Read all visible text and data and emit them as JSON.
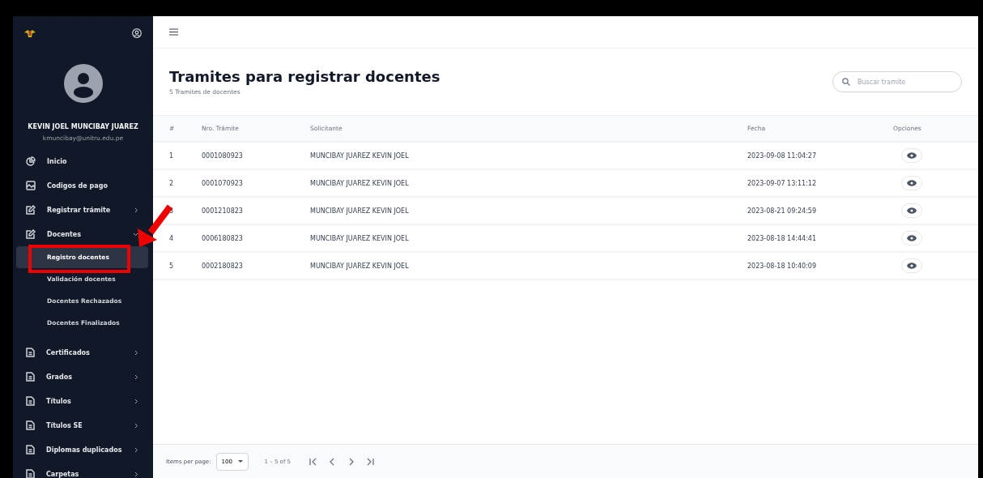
{
  "user": {
    "name": "KEVIN JOEL MUNCIBAY JUAREZ",
    "email": "kmuncibay@unitru.edu.pe"
  },
  "sidebar": {
    "items": [
      {
        "label": "Inicio",
        "kind": "chart",
        "expandable": false
      },
      {
        "label": "Codigos de pago",
        "kind": "image",
        "expandable": false
      },
      {
        "label": "Registrar trámite",
        "kind": "edit",
        "expandable": true,
        "expanded": false
      },
      {
        "label": "Docentes",
        "kind": "edit",
        "expandable": true,
        "expanded": true,
        "children": [
          {
            "label": "Registro docentes",
            "selected": true
          },
          {
            "label": "Validación docentes",
            "selected": false
          },
          {
            "label": "Docentes Rechazados",
            "selected": false
          },
          {
            "label": "Docentes Finalizados",
            "selected": false
          }
        ]
      },
      {
        "label": "Certificados",
        "kind": "doc",
        "expandable": true,
        "expanded": false
      },
      {
        "label": "Grados",
        "kind": "doc",
        "expandable": true,
        "expanded": false
      },
      {
        "label": "Títulos",
        "kind": "doc",
        "expandable": true,
        "expanded": false
      },
      {
        "label": "Títulos SE",
        "kind": "doc",
        "expandable": true,
        "expanded": false
      },
      {
        "label": "Diplomas duplicados",
        "kind": "doc",
        "expandable": true,
        "expanded": false
      },
      {
        "label": "Carpetas",
        "kind": "doc",
        "expandable": true,
        "expanded": false
      }
    ]
  },
  "header": {
    "title": "Tramites para registrar docentes",
    "subtitle": "5 Tramites de docentes"
  },
  "search": {
    "placeholder": "Buscar tramite"
  },
  "table": {
    "columns": [
      "#",
      "Nro. Trámite",
      "Solicitante",
      "Fecha",
      "Opciones"
    ],
    "rows": [
      {
        "index": "1",
        "number": "0001080923",
        "applicant": "MUNCIBAY JUAREZ KEVIN JOEL",
        "date": "2023-09-08 11:04:27"
      },
      {
        "index": "2",
        "number": "0001070923",
        "applicant": "MUNCIBAY JUAREZ KEVIN JOEL",
        "date": "2023-09-07 13:11:12"
      },
      {
        "index": "3",
        "number": "0001210823",
        "applicant": "MUNCIBAY JUAREZ KEVIN JOEL",
        "date": "2023-08-21 09:24:59"
      },
      {
        "index": "4",
        "number": "0006180823",
        "applicant": "MUNCIBAY JUAREZ KEVIN JOEL",
        "date": "2023-08-18 14:44:41"
      },
      {
        "index": "5",
        "number": "0002180823",
        "applicant": "MUNCIBAY JUAREZ KEVIN JOEL",
        "date": "2023-08-18 10:40:09"
      }
    ]
  },
  "pagination": {
    "label": "Items per page:",
    "page_size": "100",
    "range": "1 – 5 of 5"
  }
}
